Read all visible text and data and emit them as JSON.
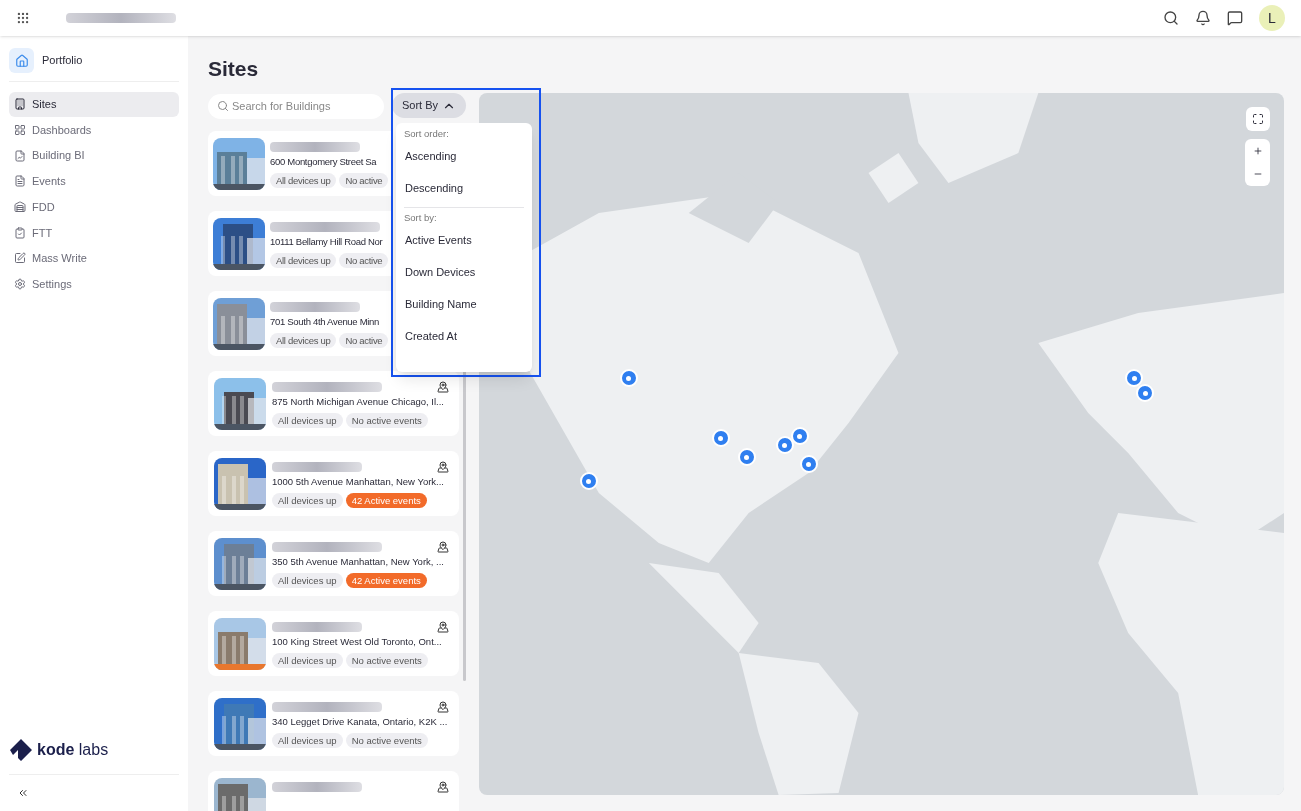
{
  "topbar": {
    "avatar": "L"
  },
  "sidebar": {
    "portfolio": "Portfolio",
    "items": [
      {
        "label": "Sites",
        "selected": true
      },
      {
        "label": "Dashboards",
        "selected": false
      },
      {
        "label": "Building BI",
        "selected": false
      },
      {
        "label": "Events",
        "selected": false
      },
      {
        "label": "FDD",
        "selected": false
      },
      {
        "label": "FTT",
        "selected": false
      },
      {
        "label": "Mass Write",
        "selected": false
      },
      {
        "label": "Settings",
        "selected": false
      }
    ],
    "logo": {
      "word1": "kode",
      "word2": "labs"
    }
  },
  "page": {
    "title": "Sites",
    "search": {
      "placeholder": "Search for Buildings"
    },
    "sort_button": {
      "label": "Sort By",
      "expanded": true
    }
  },
  "sort_menu": {
    "groups": [
      {
        "heading": "Sort order:",
        "options": [
          "Ascending",
          "Descending"
        ]
      },
      {
        "heading": "Sort by:",
        "options": [
          "Active Events",
          "Down Devices",
          "Building Name",
          "Created At"
        ]
      }
    ]
  },
  "sites": [
    {
      "address": "600 Montgomery Street Sa",
      "devices": "All devices up",
      "events": "No active",
      "alert": false,
      "locate_icon": false
    },
    {
      "address": "10111 Bellamy Hill Road Nor",
      "devices": "All devices up",
      "events": "No active",
      "alert": false,
      "locate_icon": false
    },
    {
      "address": "701 South 4th Avenue Minn",
      "devices": "All devices up",
      "events": "No active",
      "alert": false,
      "locate_icon": false
    },
    {
      "address": "875 North Michigan Avenue Chicago, Il...",
      "devices": "All devices up",
      "events": "No active events",
      "alert": false,
      "locate_icon": true
    },
    {
      "address": "1000 5th Avenue Manhattan, New York...",
      "devices": "All devices up",
      "events": "42 Active events",
      "alert": true,
      "locate_icon": true
    },
    {
      "address": "350 5th Avenue Manhattan, New York, ...",
      "devices": "All devices up",
      "events": "42 Active events",
      "alert": true,
      "locate_icon": true
    },
    {
      "address": "100 King Street West Old Toronto, Ont...",
      "devices": "All devices up",
      "events": "No active events",
      "alert": false,
      "locate_icon": true
    },
    {
      "address": "340 Legget Drive Kanata, Ontario, K2K ...",
      "devices": "All devices up",
      "events": "No active events",
      "alert": false,
      "locate_icon": true
    },
    {
      "locate_icon": true
    }
  ]
}
